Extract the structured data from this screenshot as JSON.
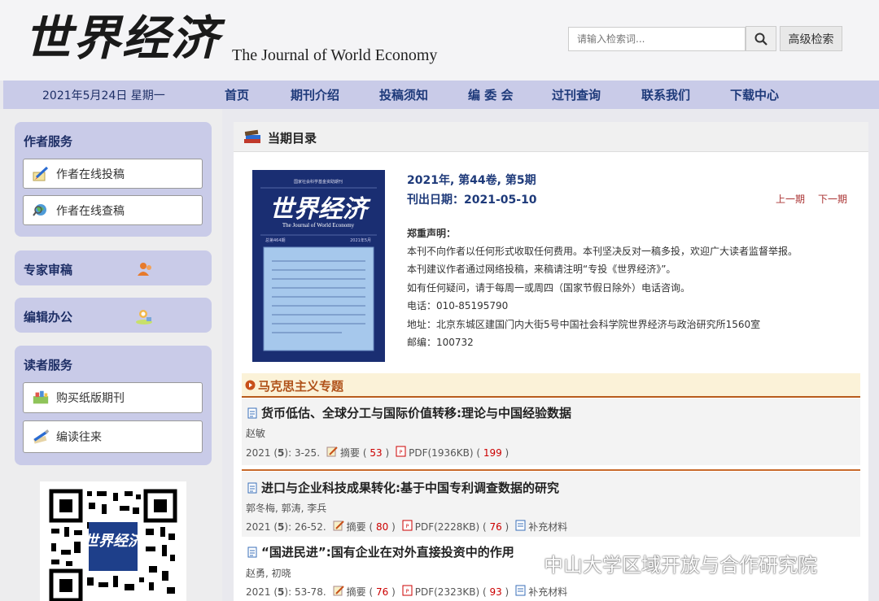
{
  "header": {
    "logo_cn": "世界经济",
    "logo_en": "The Journal of World Economy",
    "search_placeholder": "请输入检索词...",
    "advanced_search": "高级检索"
  },
  "nav": {
    "date": "2021年5月24日 星期一",
    "items": [
      "首页",
      "期刊介绍",
      "投稿须知",
      "编 委 会",
      "过刊查询",
      "联系我们",
      "下载中心"
    ]
  },
  "sidebar": {
    "author_service": "作者服务",
    "author_submit": "作者在线投稿",
    "author_query": "作者在线查稿",
    "expert_review": "专家审稿",
    "editor_office": "编辑办公",
    "reader_service": "读者服务",
    "buy_print": "购买纸版期刊",
    "editor_reader": "编读往来"
  },
  "main": {
    "heading": "当期目录",
    "issue": "2021年, 第44卷, 第5期",
    "pub_date": "刊出日期：2021-05-10",
    "prev": "上一期",
    "next": "下一期",
    "notice_title": "郑重声明：",
    "notice_lines": [
      "本刊不向作者以任何形式收取任何费用。本刊坚决反对一稿多投，欢迎广大读者监督举报。",
      "本刊建议作者通过网络投稿，来稿请注明“专投《世界经济》”。",
      "如有任何疑问，请于每周一或周四（国家节假日除外）电话咨询。",
      "电话：010-85195790",
      "地址：北京东城区建国门内大街5号中国社会科学院世界经济与政治研究所1560室",
      "邮编：100732"
    ],
    "cover": {
      "top_text": "国家社会科学基金资助期刊",
      "title_cn": "世界经济",
      "title_en": "The Journal of World Economy",
      "left_meta": "总第464期",
      "right_meta": "2021年5月"
    },
    "section": "马克思主义专题",
    "articles": [
      {
        "title": "货币低估、全球分工与国际价值转移:理论与中国经验数据",
        "authors": "赵敏",
        "year": "2021",
        "issue": "5",
        "pages": "3-25.",
        "abstract_label": "摘要",
        "abstract_count": "53",
        "pdf": "PDF(1936KB)",
        "pdf_count": "199",
        "supplement": ""
      },
      {
        "title": "进口与企业科技成果转化:基于中国专利调查数据的研究",
        "authors": "郭冬梅, 郭涛, 李兵",
        "year": "2021",
        "issue": "5",
        "pages": "26-52.",
        "abstract_label": "摘要",
        "abstract_count": "80",
        "pdf": "PDF(2228KB)",
        "pdf_count": "76",
        "supplement": "补充材料"
      },
      {
        "title": "“国进民进”:国有企业在对外直接投资中的作用",
        "authors": "赵勇, 初晓",
        "year": "2021",
        "issue": "5",
        "pages": "53-78.",
        "abstract_label": "摘要",
        "abstract_count": "76",
        "pdf": "PDF(2323KB)",
        "pdf_count": "93",
        "supplement": "补充材料"
      }
    ]
  },
  "watermark": "中山大学区域开放与合作研究院"
}
